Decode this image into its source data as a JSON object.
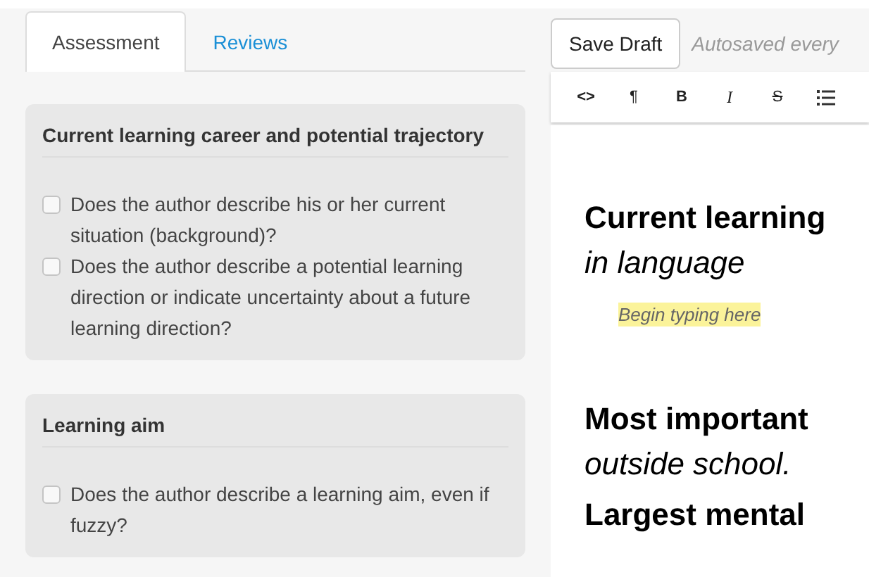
{
  "tabs": [
    {
      "label": "Assessment",
      "selected": true
    },
    {
      "label": "Reviews",
      "selected": false
    }
  ],
  "sections": [
    {
      "title": "Current learning career and potential trajectory",
      "questions": [
        {
          "text": "Does the author describe his or her current situation (background)?",
          "checked": false
        },
        {
          "text": "Does the author describe a potential learning direction or indicate uncertainty about a future learning direction?",
          "checked": false
        }
      ]
    },
    {
      "title": "Learning aim",
      "questions": [
        {
          "text": "Does the author describe a learning aim, even if fuzzy?",
          "checked": false
        }
      ]
    }
  ],
  "editor": {
    "save_button": "Save Draft",
    "autosave_note": "Autosaved every",
    "toolbar": [
      {
        "kind": "code",
        "label": "<>"
      },
      {
        "kind": "text",
        "label": "¶"
      },
      {
        "kind": "bold",
        "label": "B"
      },
      {
        "kind": "italic",
        "label": "I"
      },
      {
        "kind": "strike",
        "label": "S"
      },
      {
        "kind": "list"
      }
    ],
    "blocks": [
      {
        "kind": "heading",
        "text": "Current learning"
      },
      {
        "kind": "subheading",
        "text": "in language"
      },
      {
        "kind": "placeholder",
        "text": "Begin typing here"
      },
      {
        "kind": "heading",
        "text": "Most important"
      },
      {
        "kind": "subheading",
        "text": "outside school."
      },
      {
        "kind": "heading",
        "text": "Largest mental"
      }
    ]
  }
}
